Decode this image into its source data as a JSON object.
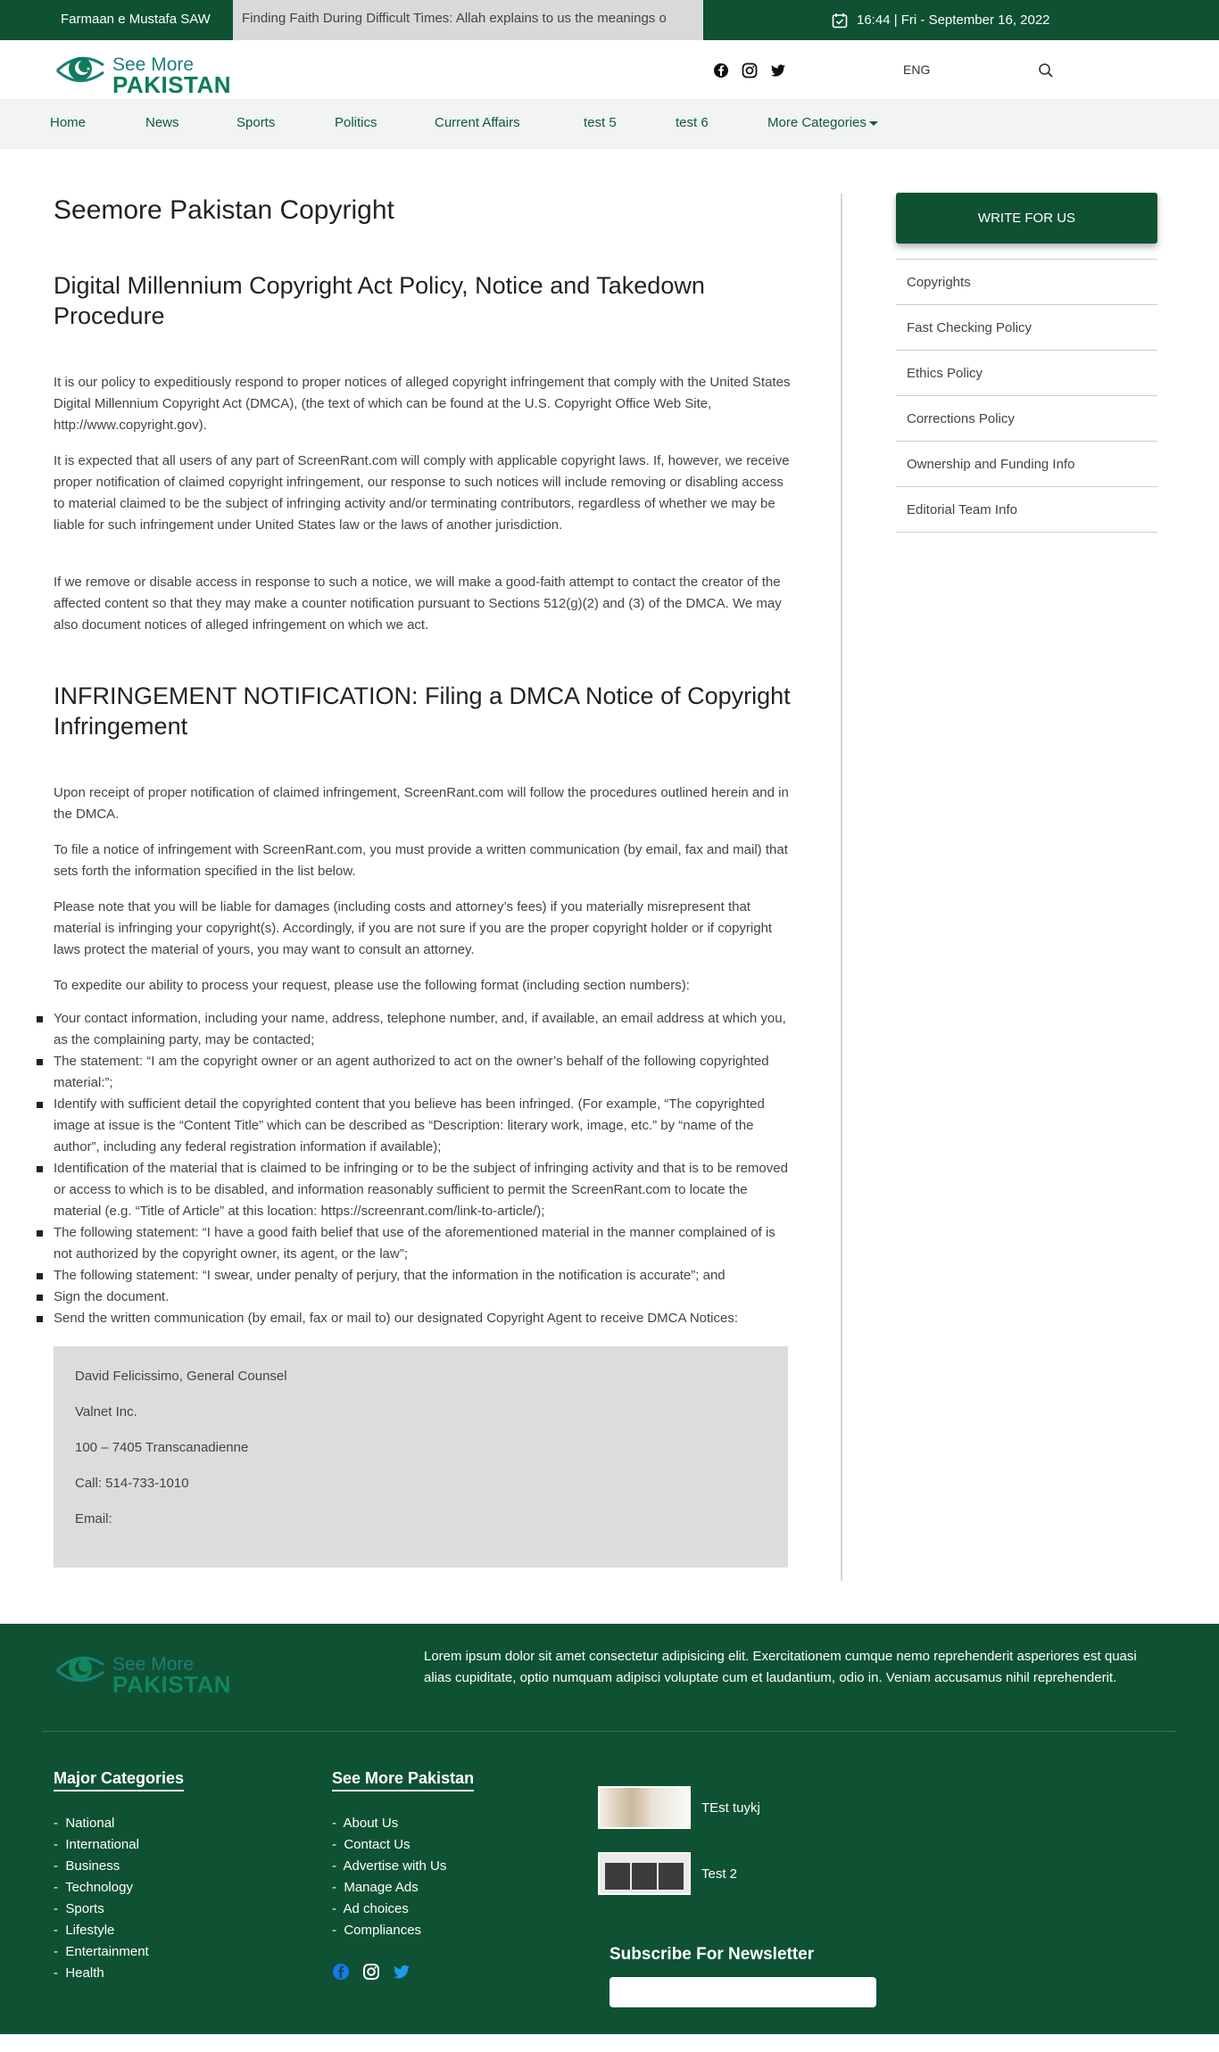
{
  "topbar": {
    "left_label": "Farmaan e Mustafa SAW",
    "ticker": "Finding Faith During Difficult Times: Allah explains to us the meanings o",
    "datetime": "16:44 | Fri - September 16, 2022"
  },
  "header": {
    "logo_top": "See More",
    "logo_bottom": "PAKISTAN",
    "language": "ENG"
  },
  "nav": {
    "items": [
      "Home",
      "News",
      "Sports",
      "Politics",
      "Current Affairs",
      "test 5",
      "test 6",
      "More Categories"
    ]
  },
  "content": {
    "title": "Seemore Pakistan Copyright",
    "h2_dmca": "Digital Millennium Copyright Act Policy, Notice and Takedown Procedure",
    "p1": "It is our policy to expeditiously respond to proper notices of alleged copyright infringement that comply with the United States Digital Millennium Copyright Act (DMCA), (the text of which can be found at the U.S. Copyright Office Web Site, http://www.copyright.gov).",
    "p2": "It is expected that all users of any part of ScreenRant.com will comply with applicable copyright laws. If, however, we receive proper notification of claimed copyright infringement, our response to such notices will include removing or disabling access to material claimed to be the subject of infringing activity and/or terminating contributors, regardless of whether we may be liable for such infringement under United States law or the laws of another jurisdiction.",
    "p3": "If we remove or disable access in response to such a notice, we will make a good-faith attempt to contact the creator of the affected content so that they may make a counter notification pursuant to Sections 512(g)(2) and (3) of the DMCA. We may also document notices of alleged infringement on which we act.",
    "h2_infringement": "INFRINGEMENT NOTIFICATION: Filing a DMCA Notice of Copyright Infringement",
    "p4": "Upon receipt of proper notification of claimed infringement, ScreenRant.com will follow the procedures outlined herein and in the DMCA.",
    "p5": "To file a notice of infringement with ScreenRant.com, you must provide a written communication (by email, fax and mail) that sets forth the information specified in the list below.",
    "p6": "Please note that you will be liable for damages (including costs and attorney’s fees) if you materially misrepresent that material is infringing your copyright(s). Accordingly, if you are not sure if you are the proper copyright holder or if copyright laws protect the material of yours, you may want to consult an attorney.",
    "p7": "To expedite our ability to process your request, please use the following format (including section numbers):",
    "bullets": [
      "Your contact information, including your name, address, telephone number, and, if available, an email address at which you, as the complaining party, may be contacted;",
      "The statement: “I am the copyright owner or an agent authorized to act on the owner’s behalf of the following copyrighted material:”;",
      "Identify with sufficient detail the copyrighted content that you believe has been infringed. (For example, “The copyrighted image at issue is the “Content Title” which can be described as “Description: literary work, image, etc.” by “name of the author”, including any federal registration information if available);",
      "Identification of the material that is claimed to be infringing or to be the subject of infringing activity and that is to be removed or access to which is to be disabled, and information reasonably sufficient to permit the ScreenRant.com to locate the material (e.g. “Title of Article” at this location: https://screenrant.com/link-to-article/);",
      "The following statement: “I have a good faith belief that use of the aforementioned material in the manner complained of is not authorized by the copyright owner, its agent, or the law”;",
      "The following statement: “I swear, under penalty of perjury, that the information in the notification is accurate”; and",
      "Sign the document.",
      "Send the written communication (by email, fax or mail to) our designated Copyright Agent to receive DMCA Notices:"
    ],
    "agent": {
      "name": "David Felicissimo, General Counsel",
      "company": "Valnet Inc.",
      "address": "100 – 7405 Transcanadienne",
      "call": "Call: 514-733-1010",
      "email": "Email:"
    }
  },
  "sidebar": {
    "button": "WRITE FOR US",
    "links": [
      "Copyrights",
      "Fast Checking Policy",
      "Ethics Policy",
      "Corrections Policy",
      "Ownership and Funding Info",
      "Editorial Team Info"
    ]
  },
  "footer": {
    "logo_top": "See More",
    "logo_bottom": "PAKISTAN",
    "description": "Lorem ipsum dolor sit amet consectetur adipisicing elit. Exercitationem cumque nemo reprehenderit asperiores est quasi alias cupiditate, optio numquam adipisci voluptate cum et laudantium, odio in. Veniam accusamus nihil reprehenderit.",
    "major_title": "Major Categories",
    "major_links": [
      "National",
      "International",
      "Business",
      "Technology",
      "Sports",
      "Lifestyle",
      "Entertainment",
      "Health"
    ],
    "smp_title": "See More Pakistan",
    "smp_links": [
      "About Us",
      "Contact Us",
      "Advertise with Us",
      "Manage Ads",
      "Ad choices",
      "Compliances"
    ],
    "posts": [
      "TEst tuykj",
      "Test 2"
    ],
    "subscribe_title": "Subscribe For Newsletter"
  },
  "colors": {
    "brand_green": "#0e5233",
    "nav_bg": "#f2f3f5",
    "agent_box_bg": "#dcdcdc"
  }
}
